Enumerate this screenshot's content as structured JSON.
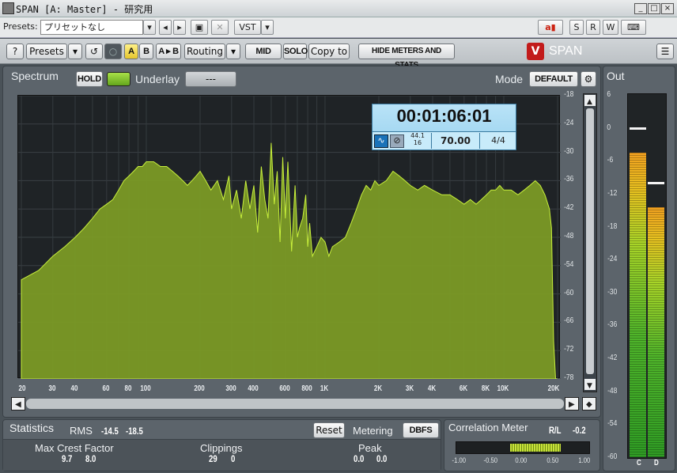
{
  "window": {
    "title": "SPAN [A: Master] - 研究用",
    "min": "_",
    "max": "□",
    "close": "×"
  },
  "presetbar": {
    "label": "Presets:",
    "preset_value": "プリセットなし",
    "vst_label": "VST",
    "right_buttons": [
      "S",
      "R",
      "W"
    ]
  },
  "toolbar": {
    "help": "?",
    "presets": "Presets",
    "a": "A",
    "b": "B",
    "a_to_b": "A ▸ B",
    "routing": "Routing",
    "mid": "MID",
    "solo": "SOLO",
    "copy_to": "Copy to",
    "hide_meters": "HIDE METERS AND STATS",
    "brand": "SPAN"
  },
  "spectrum": {
    "title": "Spectrum",
    "hold": "HOLD",
    "underlay": "Underlay",
    "underlay_value": "---",
    "mode_label": "Mode",
    "mode_value": "DEFAULT",
    "db_labels": [
      "-18",
      "-24",
      "-30",
      "-36",
      "-42",
      "-48",
      "-54",
      "-60",
      "-66",
      "-72",
      "-78"
    ],
    "freq_labels": [
      "20",
      "30",
      "40",
      "60",
      "80",
      "100",
      "200",
      "300",
      "400",
      "600",
      "800",
      "1K",
      "2K",
      "3K",
      "4K",
      "6K",
      "8K",
      "10K",
      "20K"
    ],
    "colors": {
      "fill": "#7b9a25",
      "stroke": "#c8f03c",
      "accent": "#8ec734"
    }
  },
  "chart_data": {
    "type": "area",
    "title": "",
    "xlabel": "",
    "ylabel": "",
    "x_scale": "log",
    "xlim": [
      20,
      20000
    ],
    "ylim": [
      -78,
      -18
    ],
    "x": [
      20,
      25,
      30,
      35,
      40,
      45,
      50,
      55,
      60,
      65,
      70,
      75,
      80,
      85,
      90,
      95,
      100,
      110,
      120,
      130,
      140,
      150,
      160,
      170,
      180,
      190,
      200,
      215,
      230,
      250,
      270,
      290,
      300,
      320,
      340,
      360,
      380,
      400,
      420,
      440,
      460,
      480,
      500,
      520,
      540,
      560,
      580,
      600,
      620,
      650,
      680,
      700,
      720,
      750,
      780,
      800,
      820,
      850,
      900,
      950,
      1000,
      1050,
      1100,
      1200,
      1300,
      1400,
      1500,
      1600,
      1700,
      1800,
      1900,
      2000,
      2200,
      2400,
      2600,
      2800,
      3000,
      3300,
      3600,
      4000,
      4500,
      5000,
      5500,
      6000,
      6500,
      7000,
      7500,
      8000,
      8500,
      9000,
      9500,
      10000,
      11000,
      12000,
      13000,
      14000,
      15000,
      16000,
      17000,
      18000,
      18500,
      19000,
      19500,
      20000
    ],
    "y": [
      -57,
      -55,
      -52,
      -50,
      -48,
      -46,
      -44,
      -42,
      -41,
      -40,
      -38,
      -36,
      -35,
      -34,
      -33,
      -33,
      -32,
      -32,
      -33,
      -33,
      -34,
      -35,
      -36,
      -37,
      -36,
      -35,
      -34,
      -36,
      -38,
      -36,
      -40,
      -35,
      -42,
      -38,
      -44,
      -36,
      -42,
      -37,
      -47,
      -33,
      -40,
      -44,
      -28,
      -41,
      -34,
      -49,
      -31,
      -44,
      -32,
      -51,
      -37,
      -48,
      -46,
      -44,
      -39,
      -50,
      -45,
      -52,
      -50,
      -48,
      -49,
      -52,
      -50,
      -49,
      -48,
      -45,
      -42,
      -39,
      -37,
      -38,
      -36,
      -37,
      -36,
      -34,
      -35,
      -36,
      -37,
      -38,
      -37,
      -38,
      -39,
      -39,
      -40,
      -41,
      -40,
      -41,
      -40,
      -39,
      -38,
      -38,
      -37,
      -38,
      -38,
      -39,
      -38,
      -37,
      -36,
      -37,
      -39,
      -42,
      -46,
      -70,
      -78,
      -78
    ]
  },
  "timecode": {
    "time": "00:01:06:01",
    "rate_top": "44.1",
    "rate_bottom": "16",
    "bpm": "70.00",
    "sig": "4/4"
  },
  "statistics": {
    "title": "Statistics",
    "rms_label": "RMS",
    "rms_l": "-14.5",
    "rms_r": "-18.5",
    "reset": "Reset",
    "metering_label": "Metering",
    "metering_value": "DBFS",
    "crest_label": "Max Crest Factor",
    "crest_l": "9.7",
    "crest_r": "8.0",
    "clip_label": "Clippings",
    "clip_l": "29",
    "clip_r": "0",
    "peak_label": "Peak",
    "peak_l": "0.0",
    "peak_r": "0.0"
  },
  "correlation": {
    "title": "Correlation Meter",
    "rl_label": "R/L",
    "rl_value": "-0.2",
    "scale": [
      "-1.00",
      "-0.50",
      "0.00",
      "0.50",
      "1.00"
    ]
  },
  "out": {
    "title": "Out",
    "scale": [
      "6",
      "0",
      "-6",
      "-12",
      "-18",
      "-24",
      "-30",
      "-36",
      "-42",
      "-48",
      "-54",
      "-60"
    ],
    "ch_left": "C",
    "ch_right": "D",
    "level_left_db": -4.5,
    "level_right_db": -14.5,
    "peak_left_db": 0,
    "peak_right_db": -10
  }
}
